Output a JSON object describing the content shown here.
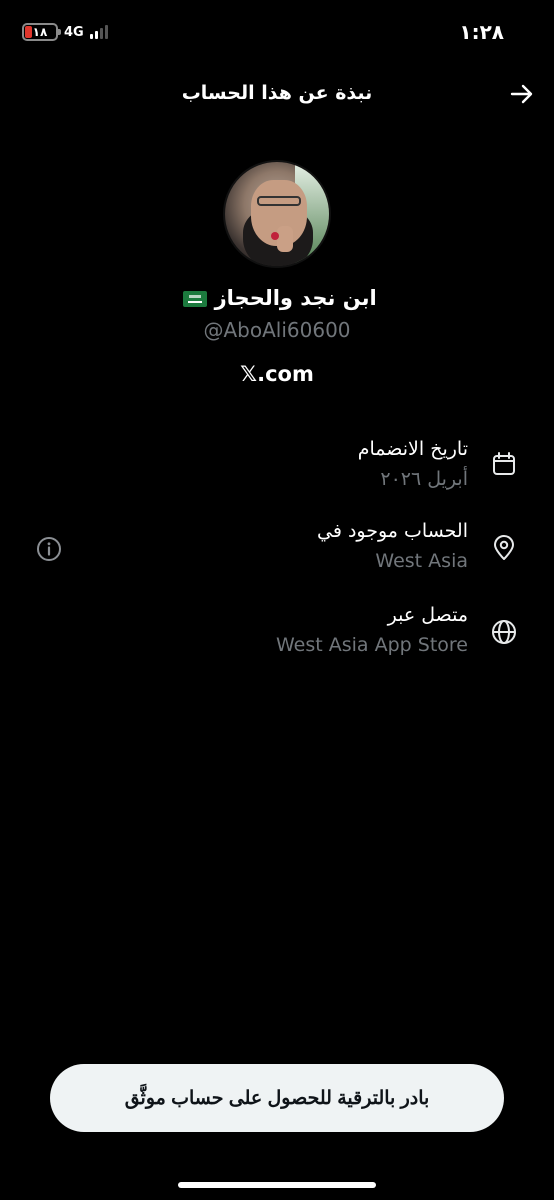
{
  "status_bar": {
    "time": "١:٢٨",
    "battery": "١٨",
    "network": "4G"
  },
  "header": {
    "title": "نبذة عن هذا الحساب"
  },
  "profile": {
    "display_name": "ابن نجد والحجاز",
    "handle": "@AboAli60600",
    "website": "𝕏.com"
  },
  "info": {
    "joined_label": "تاريخ الانضمام",
    "joined_value": "أبريل ٢٠٢٦",
    "location_label": "الحساب موجود في",
    "location_value": "West Asia",
    "connected_label": "متصل عبر",
    "connected_value": "West Asia App Store"
  },
  "upgrade": {
    "label": "بادر بالترقية للحصول على حساب موثَّق"
  },
  "colors": {
    "background": "#000000",
    "muted_text": "#71767b",
    "button_bg": "#eff3f4",
    "battery_low": "#e0362c",
    "flag_green": "#1c7a3e"
  }
}
